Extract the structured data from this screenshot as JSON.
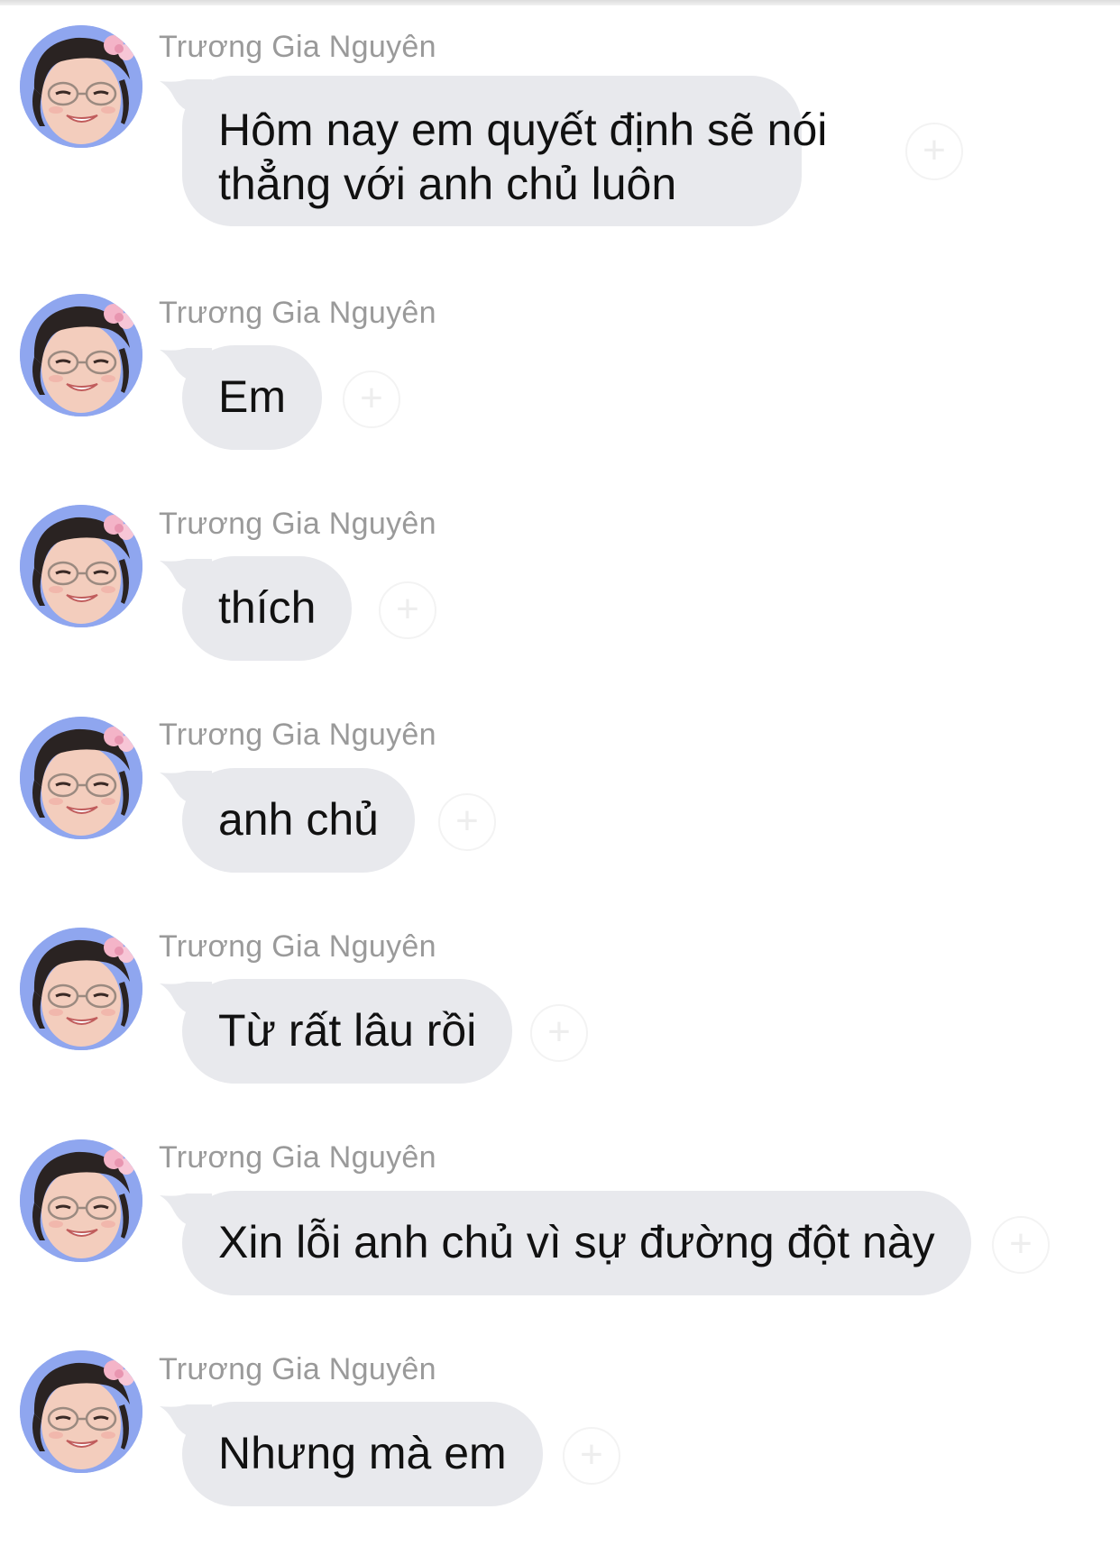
{
  "colors": {
    "bubble": "#e8e9ed",
    "sender_name": "#9a9a9a",
    "message_text": "#111111",
    "avatar_bg": "#8fa6ef"
  },
  "thread": {
    "messages": [
      {
        "sender": "Trương Gia Nguyên",
        "lines": [
          "Hôm nay em quyết định sẽ nói",
          "thẳng với anh chủ luôn"
        ]
      },
      {
        "sender": "Trương Gia Nguyên",
        "lines": [
          "Em"
        ]
      },
      {
        "sender": "Trương Gia Nguyên",
        "lines": [
          "thích"
        ]
      },
      {
        "sender": "Trương Gia Nguyên",
        "lines": [
          "anh chủ"
        ]
      },
      {
        "sender": "Trương Gia Nguyên",
        "lines": [
          "Từ rất lâu rồi"
        ]
      },
      {
        "sender": "Trương Gia Nguyên",
        "lines": [
          "Xin lỗi anh chủ vì sự đường đột này"
        ]
      },
      {
        "sender": "Trương Gia Nguyên",
        "lines": [
          "Nhưng mà em"
        ]
      }
    ],
    "reaction_icon": "add-reaction-icon"
  }
}
